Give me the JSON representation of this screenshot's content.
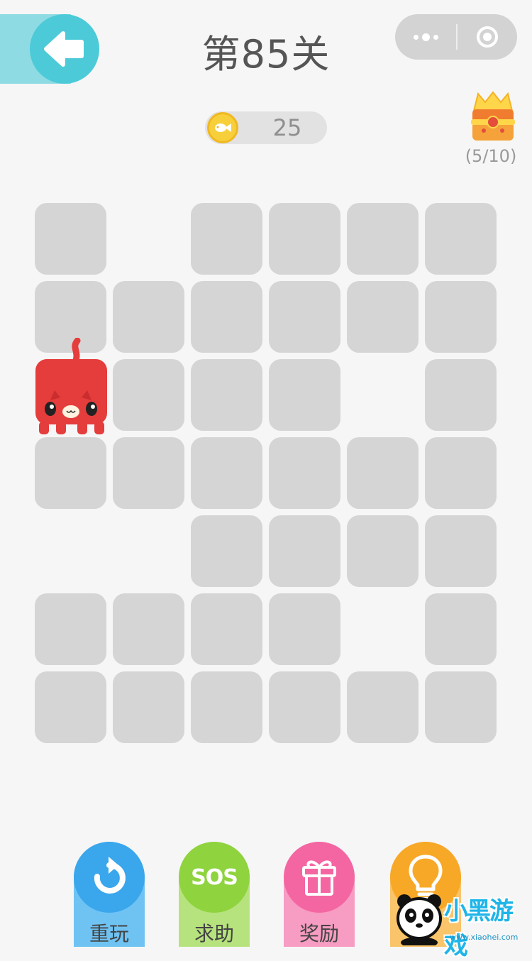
{
  "header": {
    "level_title": "第85关",
    "back_icon": "back-arrow-icon",
    "menu_icon": "more-dots-icon",
    "close_icon": "target-circle-icon"
  },
  "coins": {
    "icon": "fish-coin-icon",
    "count": "25"
  },
  "chest": {
    "icon": "treasure-chest-icon",
    "progress": "(5/10)"
  },
  "board": {
    "rows": 7,
    "cols": 6,
    "player": {
      "row": 3,
      "col": 1
    },
    "tile_color": "#d5d5d5",
    "player_color": "#e53c3c",
    "grid": [
      [
        1,
        0,
        1,
        1,
        1,
        1
      ],
      [
        1,
        1,
        1,
        1,
        1,
        1
      ],
      [
        2,
        1,
        1,
        1,
        0,
        1
      ],
      [
        1,
        1,
        1,
        1,
        1,
        1
      ],
      [
        0,
        0,
        1,
        1,
        1,
        1
      ],
      [
        1,
        1,
        1,
        1,
        0,
        1
      ],
      [
        1,
        1,
        1,
        1,
        1,
        1
      ]
    ]
  },
  "actions": [
    {
      "id": "replay",
      "label": "重玩",
      "icon": "refresh-icon",
      "color": "#3aa6ec",
      "base": "#6fc3f3"
    },
    {
      "id": "sos",
      "label": "求助",
      "icon_text": "SOS",
      "color": "#8fd33e",
      "base": "#b6e37e"
    },
    {
      "id": "reward",
      "label": "奖励",
      "icon": "gift-icon",
      "color": "#f466a2",
      "base": "#f79cc2"
    },
    {
      "id": "hint",
      "label": "",
      "icon": "lightbulb-icon",
      "color": "#f8a827",
      "base": "#f9c46a"
    }
  ],
  "watermark": {
    "title": "小黑游戏",
    "url": "www.xiaohei.com"
  }
}
